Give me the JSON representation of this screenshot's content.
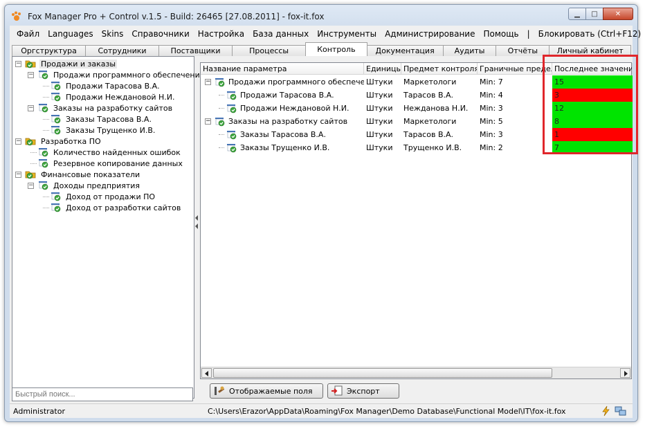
{
  "window": {
    "title": "Fox Manager Pro + Control v.1.5 - Build: 26465 [27.08.2011] - fox-it.fox",
    "minimize_glyph": "▁",
    "maximize_glyph": "□",
    "close_glyph": "✕"
  },
  "menu": [
    "Файл",
    "Languages",
    "Skins",
    "Справочники",
    "Настройка",
    "База данных",
    "Инструменты",
    "Администрирование",
    "Помощь",
    "|",
    "Блокировать (Ctrl+F12)"
  ],
  "tabs": [
    {
      "label": "Оргструктура",
      "active": false
    },
    {
      "label": "Сотрудники",
      "active": false
    },
    {
      "label": "Поставщики",
      "active": false
    },
    {
      "label": "Процессы",
      "active": false
    },
    {
      "label": "Контроль",
      "active": true
    },
    {
      "label": "Документация",
      "active": false
    },
    {
      "label": "Аудиты",
      "active": false
    },
    {
      "label": "Отчёты",
      "active": false
    },
    {
      "label": "Личный кабинет",
      "active": false
    }
  ],
  "tree": [
    {
      "label": "Продажи и заказы",
      "level": 0,
      "expanded": true,
      "type": "folder",
      "selected": true
    },
    {
      "label": "Продажи программного обеспечения",
      "level": 1,
      "expanded": true,
      "type": "group"
    },
    {
      "label": "Продажи Тарасова В.А.",
      "level": 2,
      "type": "item"
    },
    {
      "label": "Продажи Неждановой Н.И.",
      "level": 2,
      "type": "item"
    },
    {
      "label": "Заказы на разработку сайтов",
      "level": 1,
      "expanded": true,
      "type": "group"
    },
    {
      "label": "Заказы Тарасова В.А.",
      "level": 2,
      "type": "item"
    },
    {
      "label": "Заказы Трущенко И.В.",
      "level": 2,
      "type": "item"
    },
    {
      "label": "Разработка ПО",
      "level": 0,
      "expanded": true,
      "type": "folder"
    },
    {
      "label": "Количество найденных ошибок",
      "level": 1,
      "type": "item"
    },
    {
      "label": "Резервное копирование данных",
      "level": 1,
      "type": "item"
    },
    {
      "label": "Финансовые показатели",
      "level": 0,
      "expanded": true,
      "type": "folder"
    },
    {
      "label": "Доходы предприятия",
      "level": 1,
      "expanded": true,
      "type": "group"
    },
    {
      "label": "Доход от продажи ПО",
      "level": 2,
      "type": "item"
    },
    {
      "label": "Доход от разработки сайтов",
      "level": 2,
      "type": "item"
    }
  ],
  "quick_search": {
    "placeholder": "Быстрый поиск..."
  },
  "grid": {
    "columns": [
      "Название параметра",
      "Единицы",
      "Предмет контроля",
      "Граничные пределы",
      "Последнее значение"
    ],
    "rows": [
      {
        "name": "Продажи программного обеспечения",
        "level": 0,
        "units": "Штуки",
        "subject": "Маркетологи",
        "limit": "Min: 7",
        "value": "15",
        "status": "ok"
      },
      {
        "name": "Продажи Тарасова В.А.",
        "level": 1,
        "units": "Штуки",
        "subject": "Тарасов В.А.",
        "limit": "Min: 4",
        "value": "3",
        "status": "bad"
      },
      {
        "name": "Продажи Неждановой Н.И.",
        "level": 1,
        "units": "Штуки",
        "subject": "Нежданова Н.И.",
        "limit": "Min: 3",
        "value": "12",
        "status": "ok"
      },
      {
        "name": "Заказы на разработку сайтов",
        "level": 0,
        "units": "Штуки",
        "subject": "Маркетологи",
        "limit": "Min: 5",
        "value": "8",
        "status": "ok"
      },
      {
        "name": "Заказы Тарасова В.А.",
        "level": 1,
        "units": "Штуки",
        "subject": "Тарасов В.А.",
        "limit": "Min: 3",
        "value": "1",
        "status": "bad"
      },
      {
        "name": "Заказы Трущенко И.В.",
        "level": 1,
        "units": "Штуки",
        "subject": "Трущенко И.В.",
        "limit": "Min: 2",
        "value": "7",
        "status": "ok"
      }
    ]
  },
  "toolbar": {
    "fields_label": "Отображаемые поля",
    "export_label": "Экспорт"
  },
  "statusbar": {
    "user": "Administrator",
    "path": "C:\\Users\\Erazor\\AppData\\Roaming\\Fox Manager\\Demo Database\\Functional Model\\IT\\fox-it.fox"
  },
  "colors": {
    "ok": "#00e400",
    "bad": "#ff0000",
    "highlight": "#e0262b",
    "check": "#3fa63f",
    "folder": "#e6b422"
  }
}
